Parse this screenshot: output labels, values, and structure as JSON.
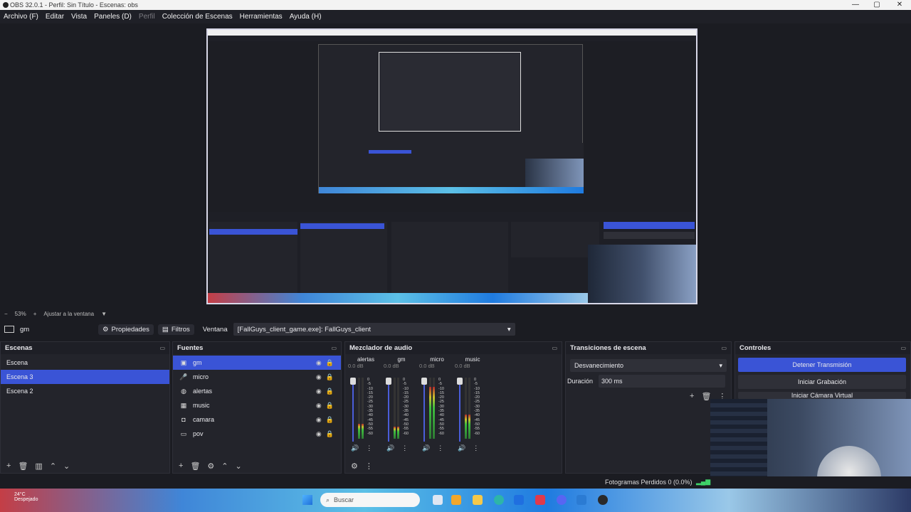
{
  "window": {
    "title": "OBS 32.0.1 - Perfil: Sin Título - Escenas: obs",
    "controls": [
      "—",
      "▢",
      "✕"
    ]
  },
  "menu": {
    "items": [
      "Archivo (F)",
      "Editar",
      "Vista",
      "Paneles (D)",
      "Perfil",
      "Colección de Escenas",
      "Herramientas",
      "Ayuda (H)"
    ]
  },
  "zoom": {
    "minus": "−",
    "value": "53%",
    "plus": "+",
    "fit_label": "Ajustar a la ventana"
  },
  "source_toolbar": {
    "selected_source": "gm",
    "properties_label": "Propiedades",
    "filters_label": "Filtros",
    "window_label": "Ventana",
    "window_value": "[FallGuys_client_game.exe]: FallGuys_client"
  },
  "scenes": {
    "title": "Escenas",
    "items": [
      "Escena",
      "Escena 3",
      "Escena 2"
    ],
    "selected_index": 1
  },
  "sources": {
    "title": "Fuentes",
    "items": [
      {
        "name": "gm",
        "icon": "window-capture-icon"
      },
      {
        "name": "micro",
        "icon": "microphone-icon"
      },
      {
        "name": "alertas",
        "icon": "browser-icon"
      },
      {
        "name": "music",
        "icon": "media-icon"
      },
      {
        "name": "camara",
        "icon": "camera-icon"
      },
      {
        "name": "pov",
        "icon": "display-icon"
      }
    ],
    "selected_index": 0
  },
  "mixer": {
    "title": "Mezclador de audio",
    "channels": [
      {
        "name": "alertas",
        "db": "0.0 dB",
        "level": 0.25
      },
      {
        "name": "gm",
        "db": "0.0 dB",
        "level": 0.2
      },
      {
        "name": "micro",
        "db": "0.0 dB",
        "level": 0.85
      },
      {
        "name": "music",
        "db": "0.0 dB",
        "level": 0.4
      }
    ],
    "ticks": [
      "0",
      "-5",
      "-10",
      "-15",
      "-20",
      "-25",
      "-30",
      "-35",
      "-40",
      "-45",
      "-50",
      "-55",
      "-60"
    ]
  },
  "transitions": {
    "title": "Transiciones de escena",
    "selected": "Desvanecimiento",
    "duration_label": "Duración",
    "duration_value": "300 ms"
  },
  "controls": {
    "title": "Controles",
    "stop_stream": "Detener Transmisión",
    "start_recording": "Iniciar Grabación",
    "virtual_camera": "Iniciar Cámara Virtual"
  },
  "status": {
    "dropped_frames": "Fotogramas Perdidos 0 (0.0%)"
  },
  "taskbar": {
    "weather_temp": "24°C",
    "weather_desc": "Despejado",
    "search_placeholder": "Buscar"
  },
  "colors": {
    "accent": "#3a54d6",
    "dock_bg": "#23242b",
    "app_bg": "#1b1c22"
  }
}
